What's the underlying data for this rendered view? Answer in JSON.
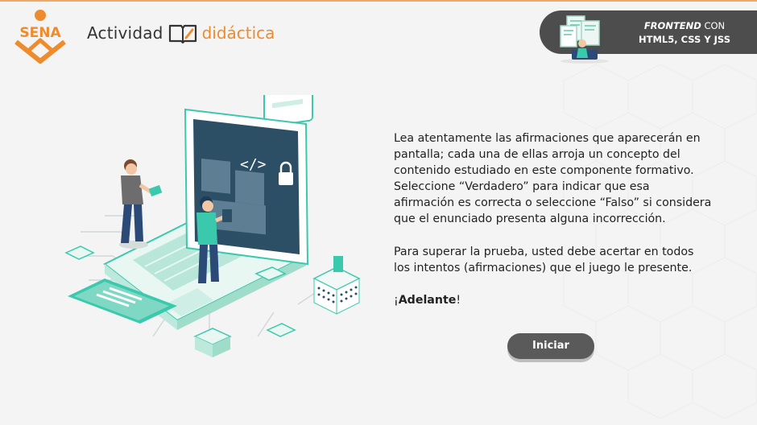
{
  "header": {
    "logo_text": "SENA",
    "activity_label": "Actividad",
    "didactica_label": "didáctica",
    "course": {
      "line1_em": "FRONTEND",
      "line1_rest": " CON",
      "line2": "HTML5, CSS Y JSS"
    }
  },
  "instructions": {
    "paragraph1": "Lea atentamente las afirmaciones que aparecerán en pantalla; cada una de ellas arroja un concepto del contenido estudiado en este componente formativo. Seleccione “Verdadero” para indicar que esa afirmación es correcta o seleccione “Falso” si considera que el enunciado presenta alguna incorrección.",
    "paragraph2": "Para superar la prueba, usted debe acertar en todos los intentos (afirmaciones) que el juego le presente.",
    "exclaim_open": "¡",
    "exclaim_word": "Adelante",
    "exclaim_close": "!"
  },
  "start_button": {
    "label": "Iniciar"
  },
  "colors": {
    "sena_orange": "#ee8b2c",
    "badge_gray": "#4d4d4d",
    "button_gray": "#5a5a5a",
    "teal": "#3bc9ae"
  },
  "icons": [
    "sena-logo-icon",
    "book-icon",
    "course-illustration-icon",
    "laptop-illustration-icon"
  ]
}
